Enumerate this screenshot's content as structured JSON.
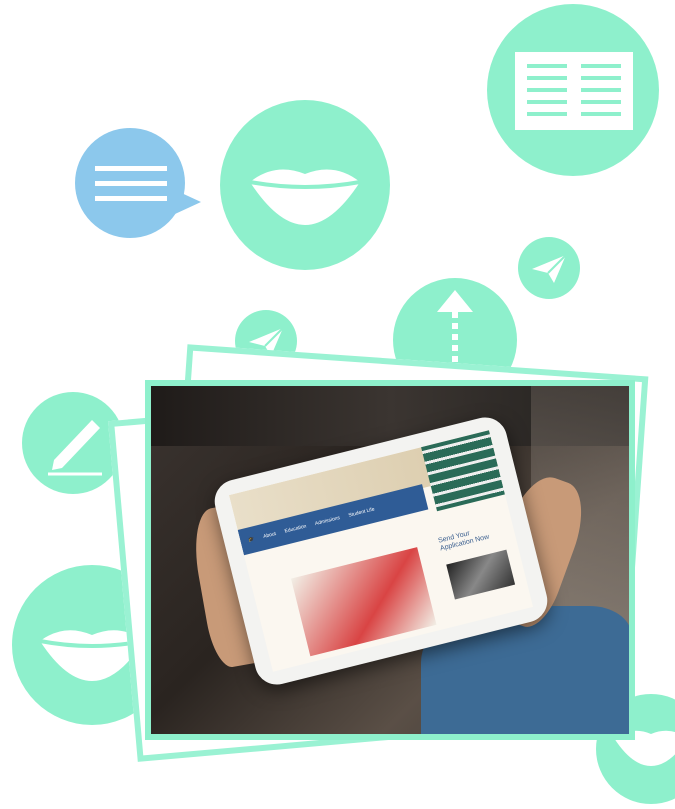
{
  "tablet_site": {
    "nav_items": [
      "About",
      "Education",
      "Admissions",
      "Student Life"
    ],
    "cta_text": "Send Your Application Now"
  },
  "icons": [
    "chat-lines-icon",
    "lips-icon",
    "document-text-icon",
    "paper-plane-icon",
    "arrow-up-icon",
    "pencil-icon"
  ],
  "colors": {
    "mint": "#8ef0cc",
    "blue": "#8cc8ec",
    "nav_blue": "#2f5c96"
  }
}
